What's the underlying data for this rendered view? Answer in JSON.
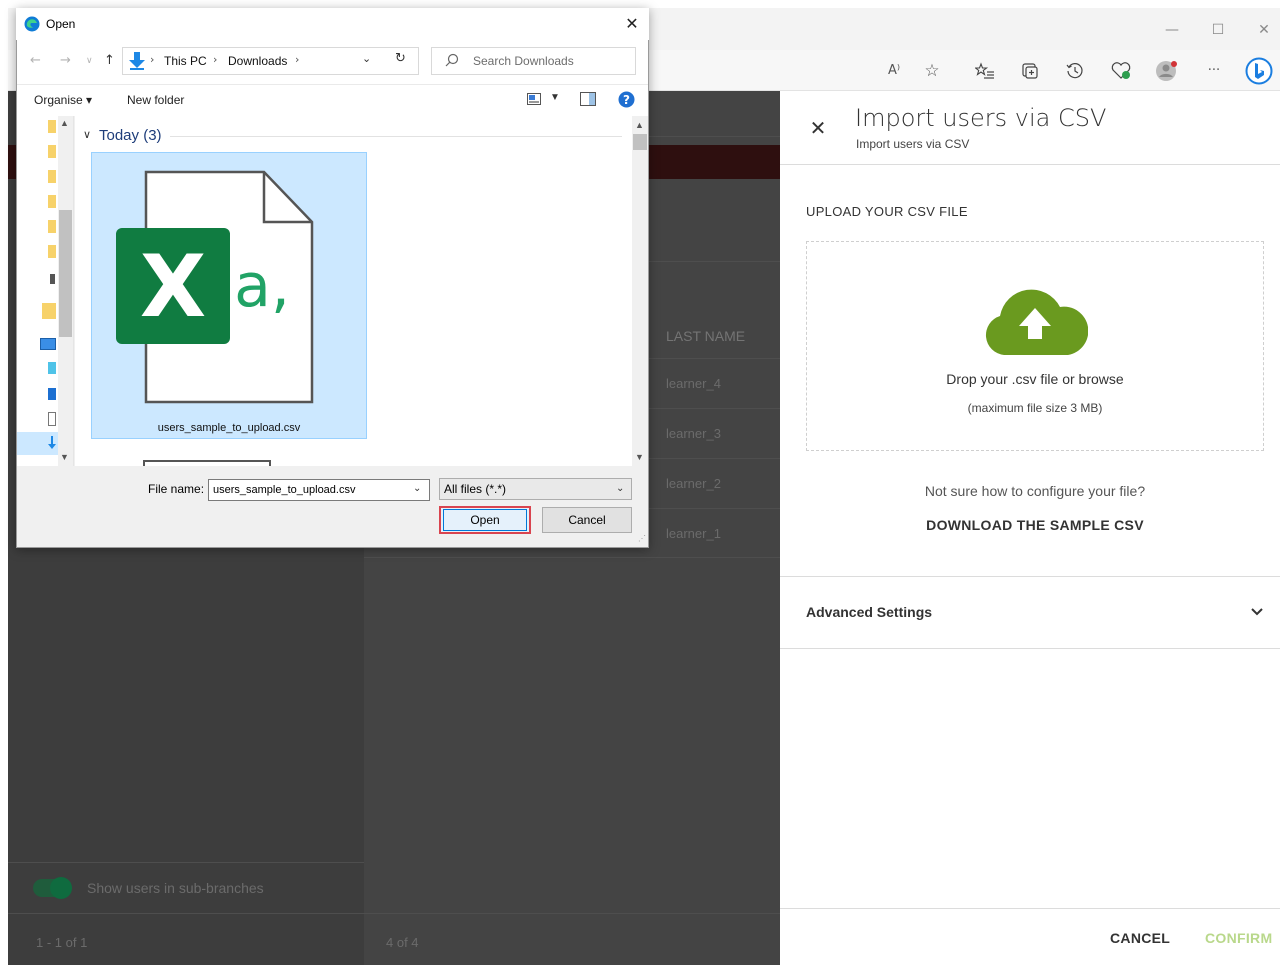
{
  "browser": {
    "window_controls": [
      "—",
      "☐",
      "✕"
    ],
    "toolbar_icons": [
      "read-aloud-icon",
      "favorite-star-icon",
      "favorites-list-icon",
      "collections-icon",
      "history-icon",
      "browser-essentials-icon",
      "profile-icon",
      "more-icon",
      "bing-icon"
    ],
    "read_aloud_glyph": "A⁾",
    "star_glyph": "☆",
    "more_glyph": "···"
  },
  "page": {
    "column_header": "LAST NAME",
    "rows": [
      "learner_4",
      "learner_3",
      "learner_2",
      "learner_1"
    ],
    "toggle_label": "Show users in sub-branches",
    "pager_left": "1 - 1 of 1",
    "pager_mid": "4 of 4"
  },
  "drawer": {
    "title": "Import users via CSV",
    "subtitle": "Import users via CSV",
    "upload_label": "UPLOAD YOUR CSV FILE",
    "drop_text": "Drop your .csv file or browse",
    "drop_max": "(maximum file size 3 MB)",
    "not_sure": "Not sure how to configure your file?",
    "download_sample": "DOWNLOAD THE SAMPLE CSV",
    "advanced": "Advanced Settings",
    "cancel": "CANCEL",
    "confirm": "CONFIRM",
    "accent_color": "#6a9a1f",
    "confirm_color": "#b9d88b"
  },
  "dialog": {
    "title": "Open",
    "breadcrumb": [
      "This PC",
      "Downloads"
    ],
    "search_placeholder": "Search Downloads",
    "organise": "Organise ▾",
    "new_folder": "New folder",
    "group_label": "Today (3)",
    "file_name_label": "File name:",
    "file_name_value": "users_sample_to_upload.csv",
    "file_tile_label": "users_sample_to_upload.csv",
    "filter": "All files (*.*)",
    "open": "Open",
    "cancel": "Cancel",
    "selection_color": "#cce8ff"
  }
}
